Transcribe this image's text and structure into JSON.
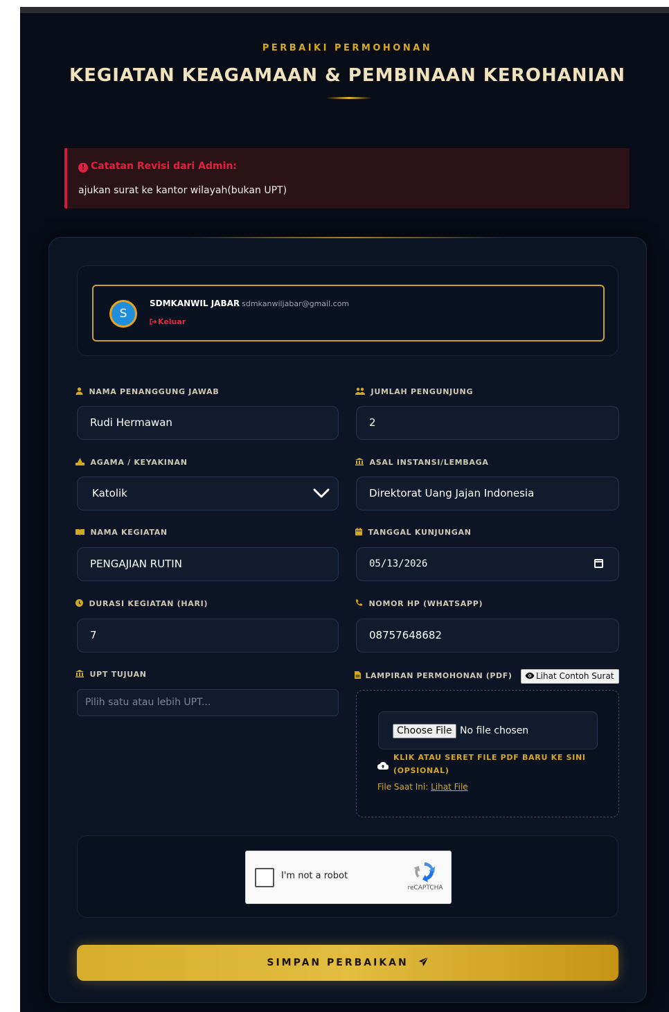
{
  "header": {
    "eyebrow": "PERBAIKI PERMOHONAN",
    "title": "KEGIATAN KEAGAMAAN & PEMBINAAN KEROHANIAN"
  },
  "alert": {
    "title": "Catatan Revisi dari Admin:",
    "icon": "!",
    "message": "ajukan surat ke kantor wilayah(bukan UPT)"
  },
  "user": {
    "avatar_initial": "S",
    "name": "SDMKANWIL JABAR",
    "email": "sdmkanwiljabar@gmail.com",
    "logout_label": "Keluar"
  },
  "form": {
    "penanggung_jawab": {
      "label": "NAMA PENANGGUNG JAWAB",
      "value": "Rudi Hermawan"
    },
    "jumlah_pengunjung": {
      "label": "JUMLAH PENGUNJUNG",
      "value": "2"
    },
    "agama": {
      "label": "AGAMA / KEYAKINAN",
      "value": "Katolik"
    },
    "asal_instansi": {
      "label": "ASAL INSTANSI/LEMBAGA",
      "value": "Direktorat Uang Jajan Indonesia"
    },
    "nama_kegiatan": {
      "label": "NAMA KEGIATAN",
      "value": "PENGAJIAN RUTIN"
    },
    "tanggal_kunjungan": {
      "label": "TANGGAL KUNJUNGAN",
      "value": "05/13/2026"
    },
    "durasi": {
      "label": "DURASI KEGIATAN (HARI)",
      "value": "7"
    },
    "nomor_hp": {
      "label": "NOMOR HP (WHATSAPP)",
      "value": "08757648682"
    },
    "upt_tujuan": {
      "label": "UPT TUJUAN",
      "placeholder": "Pilih satu atau lebih UPT..."
    },
    "lampiran": {
      "label": "LAMPIRAN PERMOHONAN (PDF)",
      "contoh_button": "Lihat Contoh Surat",
      "choose_label": "Choose File",
      "no_file": "No file chosen",
      "drop_text": "KLIK ATAU SERET FILE PDF BARU KE SINI (OPSIONAL)",
      "current_label": "File Saat Ini:",
      "current_link": "Lihat File"
    }
  },
  "captcha": {
    "label": "I'm not a robot",
    "brand": "reCAPTCHA"
  },
  "submit_label": "SIMPAN PERBAIKAN",
  "colors": {
    "background": "#080c16",
    "card": "#0c1425",
    "accent_gold": "#d4a81f",
    "danger": "#e0213f",
    "title": "#f0e2bc"
  },
  "icons": {
    "penanggung_jawab": "user-icon",
    "jumlah_pengunjung": "users-icon",
    "agama": "praying-hands-icon",
    "asal_instansi": "building-icon",
    "nama_kegiatan": "book-icon",
    "tanggal_kunjungan": "calendar-icon",
    "durasi": "clock-icon",
    "nomor_hp": "phone-icon",
    "upt_tujuan": "landmark-icon",
    "lampiran": "file-icon"
  }
}
